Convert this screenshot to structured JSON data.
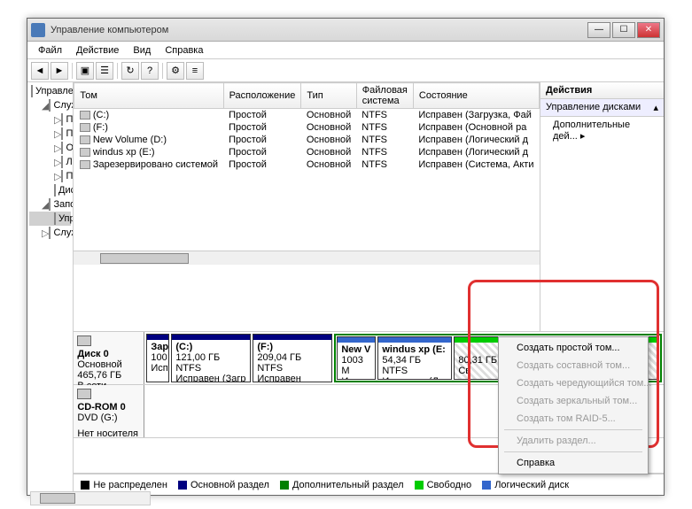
{
  "window": {
    "title": "Управление компьютером"
  },
  "menu": {
    "file": "Файл",
    "action": "Действие",
    "view": "Вид",
    "help": "Справка"
  },
  "tree": {
    "root": "Управление компьютером (л",
    "sys": "Служебные программы",
    "sched": "Планировщик заданий",
    "event": "Просмотр событий",
    "shared": "Общие папки",
    "users": "Локальные пользов",
    "perf": "Производительност",
    "devmgr": "Диспетчер устройст",
    "storage": "Запоминающие устройс",
    "diskmgmt": "Управление дисками",
    "services": "Службы и приложения"
  },
  "cols": {
    "vol": "Том",
    "layout": "Расположение",
    "type": "Тип",
    "fs": "Файловая система",
    "status": "Состояние"
  },
  "vols": [
    {
      "name": "(C:)",
      "layout": "Простой",
      "type": "Основной",
      "fs": "NTFS",
      "status": "Исправен (Загрузка, Фай"
    },
    {
      "name": "(F:)",
      "layout": "Простой",
      "type": "Основной",
      "fs": "NTFS",
      "status": "Исправен (Основной ра"
    },
    {
      "name": "New Volume (D:)",
      "layout": "Простой",
      "type": "Основной",
      "fs": "NTFS",
      "status": "Исправен (Логический д"
    },
    {
      "name": "windus xp (E:)",
      "layout": "Простой",
      "type": "Основной",
      "fs": "NTFS",
      "status": "Исправен (Логический д"
    },
    {
      "name": "Зарезервировано системой",
      "layout": "Простой",
      "type": "Основной",
      "fs": "NTFS",
      "status": "Исправен (Система, Акти"
    }
  ],
  "actions": {
    "hdr": "Действия",
    "item": "Управление дисками",
    "more": "Дополнительные дей..."
  },
  "disk0": {
    "name": "Диск 0",
    "type": "Основной",
    "size": "465,76 ГБ",
    "state": "В сети",
    "p0": {
      "l1": "Зар",
      "l2": "100",
      "l3": "Исп"
    },
    "p1": {
      "l1": "(C:)",
      "l2": "121,00 ГБ NTFS",
      "l3": "Исправен (Загр"
    },
    "p2": {
      "l1": "(F:)",
      "l2": "209,04 ГБ NTFS",
      "l3": "Исправен (Осно"
    },
    "p3": {
      "l1": "New V",
      "l2": "1003 M",
      "l3": "Исправе"
    },
    "p4": {
      "l1": "windus xp  (E:",
      "l2": "54,34 ГБ NTFS",
      "l3": "Исправен (Ло"
    },
    "p5": {
      "l1": "",
      "l2": "80,31 ГБ",
      "l3": "Св"
    }
  },
  "cdrom": {
    "name": "CD-ROM 0",
    "dev": "DVD (G:)",
    "state": "Нет носителя"
  },
  "legend": {
    "unalloc": "Не распределен",
    "primary": "Основной раздел",
    "ext": "Дополнительный раздел",
    "free": "Свободно",
    "logical": "Логический диск"
  },
  "ctx": {
    "simple": "Создать простой том...",
    "spanned": "Создать составной том...",
    "striped": "Создать чередующийся том...",
    "mirror": "Создать зеркальный том...",
    "raid5": "Создать том RAID-5...",
    "delete": "Удалить раздел...",
    "help": "Справка"
  }
}
